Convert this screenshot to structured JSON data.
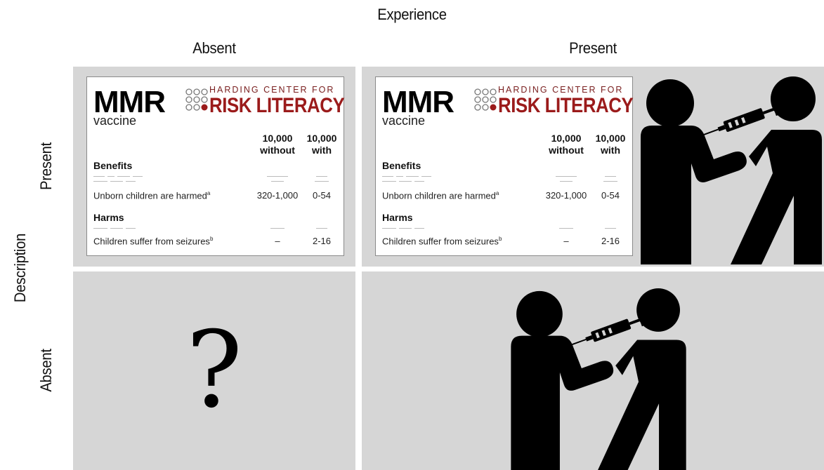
{
  "header": {
    "experience": "Experience",
    "absent": "Absent",
    "present": "Present"
  },
  "side": {
    "description": "Description",
    "present": "Present",
    "absent": "Absent"
  },
  "card": {
    "title": "MMR",
    "subtitle": "vaccine",
    "org_line1": "HARDING CENTER FOR",
    "org_line2": "RISK LITERACY",
    "col_without_top": "10,000",
    "col_without_bottom": "without",
    "col_with_top": "10,000",
    "col_with_bottom": "with",
    "benefits": "Benefits",
    "benefit_row": "Unborn children are harmed",
    "benefit_row_note": "a",
    "benefit_without": "320-1,000",
    "benefit_with": "0-54",
    "harms": "Harms",
    "harm_row": "Children suffer from seizures",
    "harm_row_note": "b",
    "harm_without": "–",
    "harm_with": "2-16"
  },
  "unknown_cell": "?",
  "icons": [
    "vaccination-icon",
    "vaccination-icon"
  ],
  "colors": {
    "cell_bg": "#d6d6d6",
    "logo_red": "#9b1b1b"
  }
}
